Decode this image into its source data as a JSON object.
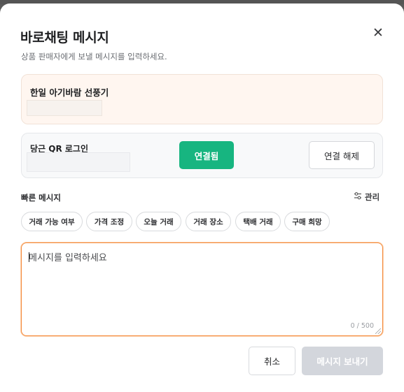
{
  "modal": {
    "title": "바로채팅 메시지",
    "subtitle": "상품 판매자에게 보낼 메시지를 입력하세요.",
    "close_icon": "✕"
  },
  "product": {
    "name": "한일 아기바람 선풍기"
  },
  "login": {
    "label": "당근 QR 로그인",
    "connected_label": "연결됨",
    "disconnect_label": "연결 해제",
    "connected_color": "#17b580"
  },
  "quick": {
    "title": "빠른 메시지",
    "manage_label": "관리",
    "manage_icon": "sliders-icon",
    "chips": [
      "거래 가능 여부",
      "가격 조정",
      "오늘 거래",
      "거래 장소",
      "택배 거래",
      "구매 희망"
    ]
  },
  "message": {
    "placeholder": "메시지를 입력하세요",
    "value": "",
    "counter": "0 / 500",
    "focus_color": "#f58a3a"
  },
  "footer": {
    "cancel_label": "취소",
    "send_label": "메시지 보내기"
  }
}
